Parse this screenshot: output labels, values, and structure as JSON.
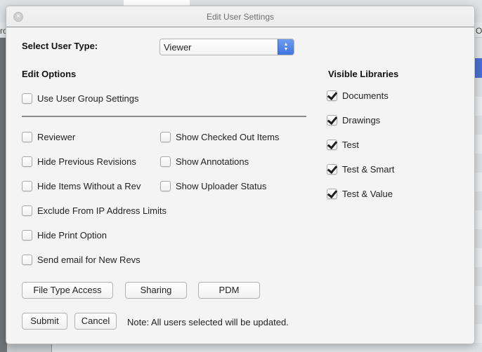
{
  "background": {
    "left_fragment": "ro",
    "right_fragment": "Op"
  },
  "dialog": {
    "title": "Edit User Settings",
    "close_icon": "close-icon",
    "select_user_type_label": "Select User Type:",
    "user_type": {
      "selected": "Viewer",
      "arrow_icon": "up-down-chevron-icon",
      "accent": "#4a7fe6"
    },
    "edit_options_heading": "Edit Options",
    "use_group_settings": {
      "label": "Use User Group Settings",
      "checked": false
    },
    "options_left": [
      {
        "label": "Reviewer",
        "checked": false
      },
      {
        "label": "Hide Previous Revisions",
        "checked": false
      },
      {
        "label": "Hide Items Without a Rev",
        "checked": false
      },
      {
        "label": "Exclude From IP Address Limits",
        "checked": false
      },
      {
        "label": "Hide Print Option",
        "checked": false
      },
      {
        "label": "Send email for New Revs",
        "checked": false
      }
    ],
    "options_right": [
      {
        "label": "Show Checked Out Items",
        "checked": false
      },
      {
        "label": "Show Annotations",
        "checked": false
      },
      {
        "label": "Show Uploader Status",
        "checked": false
      }
    ],
    "visible_libraries_heading": "Visible Libraries",
    "libraries": [
      {
        "label": "Documents",
        "checked": true
      },
      {
        "label": "Drawings",
        "checked": true
      },
      {
        "label": "Test",
        "checked": true
      },
      {
        "label": "Test & Smart",
        "checked": true
      },
      {
        "label": "Test & Value",
        "checked": true
      }
    ],
    "buttons": {
      "file_type_access": "File Type Access",
      "sharing": "Sharing",
      "pdm": "PDM",
      "submit": "Submit",
      "cancel": "Cancel"
    },
    "note": "Note: All users selected will be updated."
  }
}
